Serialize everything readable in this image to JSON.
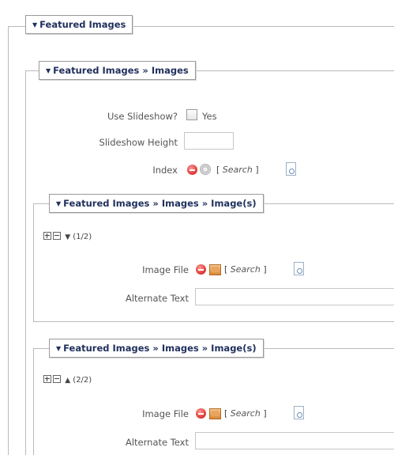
{
  "sections": {
    "featured": {
      "title": "Featured Images"
    },
    "images": {
      "title": "Featured Images » Images"
    },
    "image1": {
      "title": "Featured Images » Images » Image(s)",
      "counter": "(1/2)"
    },
    "image2": {
      "title": "Featured Images » Images » Image(s)",
      "counter": "(2/2)"
    }
  },
  "fields": {
    "use_slideshow_label": "Use Slideshow?",
    "use_slideshow_option": "Yes",
    "slideshow_height_label": "Slideshow Height",
    "slideshow_height_value": "",
    "index_label": "Index",
    "image_file_label": "Image File",
    "alternate_text_label": "Alternate Text",
    "alternate_text_value": ""
  },
  "search": {
    "label": "Search"
  },
  "icons": {
    "collapse": "triangle-down-icon",
    "remove": "remove-icon",
    "browse": "gear-icon",
    "image": "image-icon",
    "document": "document-icon"
  }
}
